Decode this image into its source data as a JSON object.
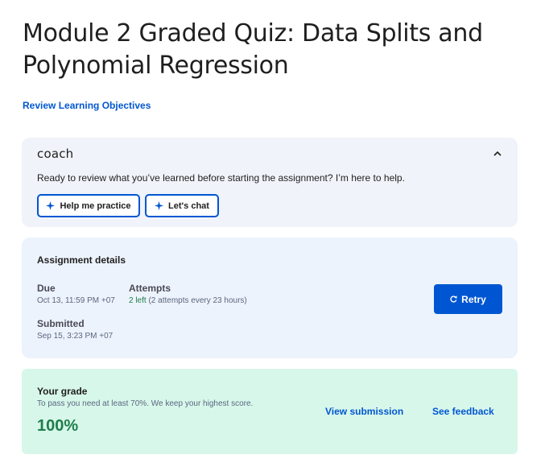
{
  "header": {
    "title": "Module 2 Graded Quiz: Data Splits and Polynomial Regression",
    "objectives_link": "Review Learning Objectives"
  },
  "coach": {
    "logo": "coach",
    "prompt": "Ready to review what you’ve learned before starting the assignment? I’m here to help.",
    "buttons": {
      "practice": "Help me practice",
      "chat": "Let's chat"
    },
    "icons": {
      "collapse": "chevron-up-icon",
      "spark": "sparkle-icon"
    }
  },
  "assignment": {
    "heading": "Assignment details",
    "due_label": "Due",
    "due_value": "Oct 13, 11:59 PM +07",
    "attempts_label": "Attempts",
    "attempts_left": "2 left",
    "attempts_detail": " (2 attempts every 23 hours)",
    "submitted_label": "Submitted",
    "submitted_value": "Sep 15, 3:23 PM +07",
    "retry_label": "Retry"
  },
  "grade": {
    "heading": "Your grade",
    "hint": "To pass you need at least 70%. We keep your highest score.",
    "value": "100%",
    "view_submission": "View submission",
    "see_feedback": "See feedback"
  },
  "colors": {
    "accent": "#0056d2",
    "success": "#1e7e4a",
    "coach_bg": "#f0f3f9",
    "details_bg": "#edf3fc",
    "grade_bg": "#d7f7ea"
  }
}
